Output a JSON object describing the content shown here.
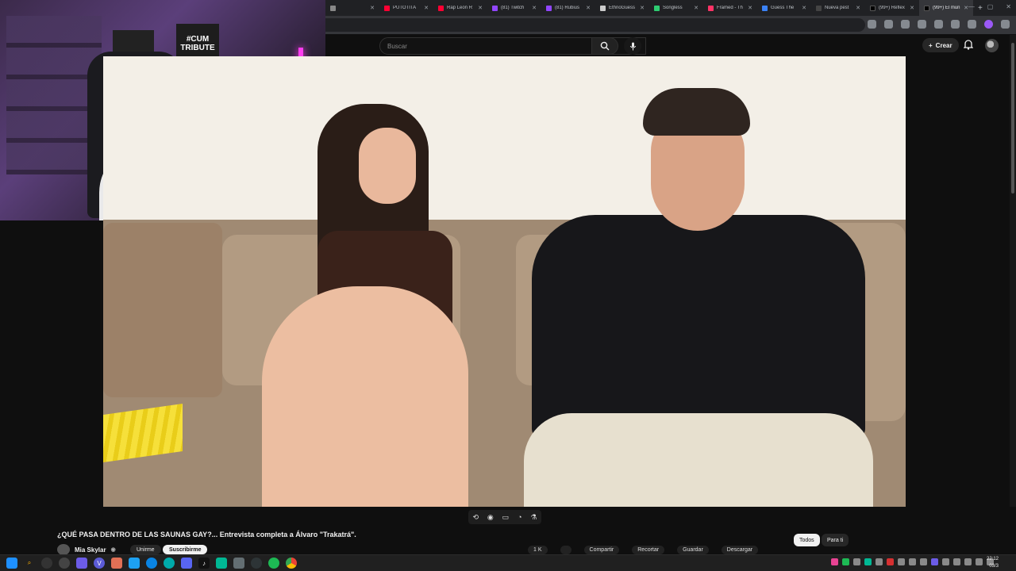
{
  "browser": {
    "tabs": [
      {
        "label": "",
        "color": "#888888"
      },
      {
        "label": "PUTOTITA",
        "color": "#ff0033"
      },
      {
        "label": "Rap Leon R",
        "color": "#ff0033"
      },
      {
        "label": "(81) Twitch",
        "color": "#9146ff"
      },
      {
        "label": "(81) Rubius",
        "color": "#9146ff"
      },
      {
        "label": "EthnoGuess",
        "color": "#cccccc"
      },
      {
        "label": "Songless",
        "color": "#2ecc71"
      },
      {
        "label": "Framed - Th",
        "color": "#ff3366"
      },
      {
        "label": "Guess The",
        "color": "#3b82f6"
      },
      {
        "label": "Nueva pest",
        "color": "#444444"
      },
      {
        "label": "(99+) Reflex",
        "color": "#000000"
      },
      {
        "label": "(99+) El mun",
        "color": "#000000"
      }
    ],
    "new_tab": "+"
  },
  "youtube": {
    "search_placeholder": "Buscar",
    "create_label": "Crear",
    "video_title": "¿QUÉ PASA DENTRO DE LAS SAUNAS GAY?... Entrevista completa a Álvaro \"Trakatrá\".",
    "channel_name": "Mia Skylar",
    "join_label": "Unirme",
    "subscribe_label": "Suscribirme",
    "actions": [
      "1 K",
      "",
      "Compartir",
      "Recortar",
      "Guardar",
      "Descargar"
    ],
    "chips": [
      "Todos",
      "Para ti"
    ]
  },
  "webcam": {
    "poster_text": "#CUM TRIBUTE"
  },
  "taskbar": {
    "time": "22:12",
    "date": "03/3",
    "icons": [
      "windows",
      "search",
      "taskview",
      "app",
      "vivaldi",
      "app2",
      "edge",
      "app3",
      "discord",
      "tiktok",
      "app4",
      "app5",
      "app6",
      "spotify",
      "chrome"
    ]
  }
}
